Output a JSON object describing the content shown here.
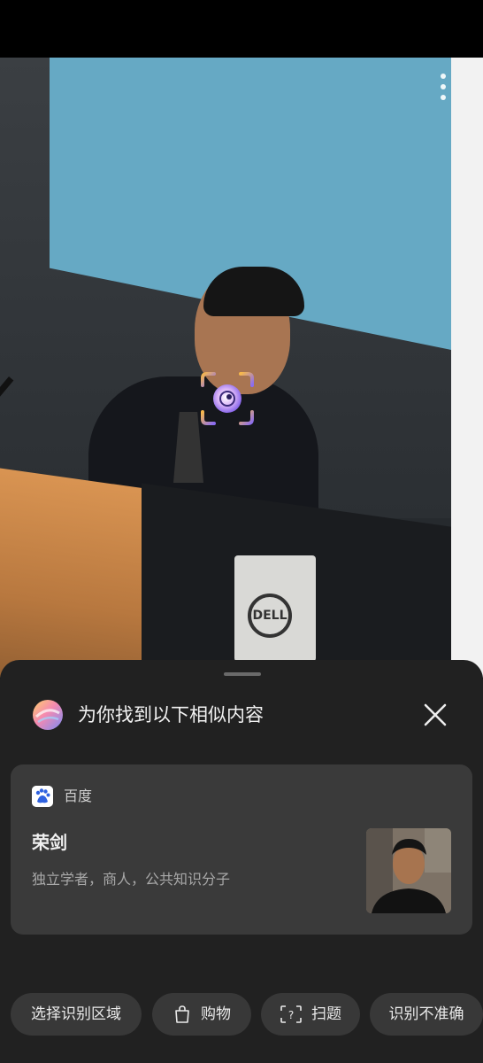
{
  "viewer": {
    "more_icon": "more-vertical-icon",
    "focus_icon": "face-scan-icon",
    "photo_logo_text": "DELL"
  },
  "sheet": {
    "title": "为你找到以下相似内容",
    "logo_icon": "assistant-orb-icon",
    "close_icon": "close-icon"
  },
  "result": {
    "source": "百度",
    "source_icon": "baidu-paw-icon",
    "name": "荣剑",
    "description": "独立学者，商人，公共知识分子"
  },
  "actions": [
    {
      "label": "选择识别区域",
      "icon": ""
    },
    {
      "label": "购物",
      "icon": "shopping-bag-icon"
    },
    {
      "label": "扫题",
      "icon": "scan-question-icon"
    },
    {
      "label": "识别不准确",
      "icon": ""
    }
  ],
  "colors": {
    "sheet_background": "#212121",
    "card_background": "#3a3a3a",
    "chip_background": "#383838",
    "focus_gradient_start": "#f7b84b",
    "focus_gradient_end": "#8a6cf2"
  }
}
